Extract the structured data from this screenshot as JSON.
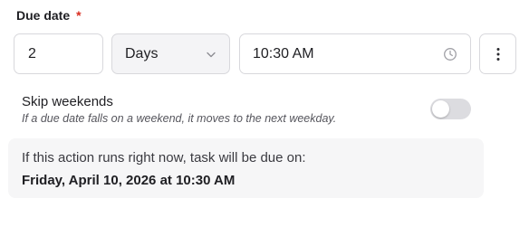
{
  "due_date": {
    "label": "Due date",
    "required_marker": "*",
    "amount_value": "2",
    "unit_selected": "Days",
    "time_value": "10:30 AM"
  },
  "skip_weekends": {
    "label": "Skip weekends",
    "help_text": "If a due date falls on a weekend, it moves to the next weekday.",
    "enabled": false
  },
  "preview": {
    "intro": "If this action runs right now, task will be due on:",
    "date": "Friday, April 10, 2026 at 10:30 AM"
  },
  "icons": {
    "unit_dropdown": "chevron-down-icon",
    "time_picker": "clock-icon",
    "more_options": "vertical-ellipsis-icon"
  },
  "colors": {
    "required": "#d92d20",
    "toggle_off": "#dcdce0",
    "preview_bg": "#f6f6f7"
  }
}
